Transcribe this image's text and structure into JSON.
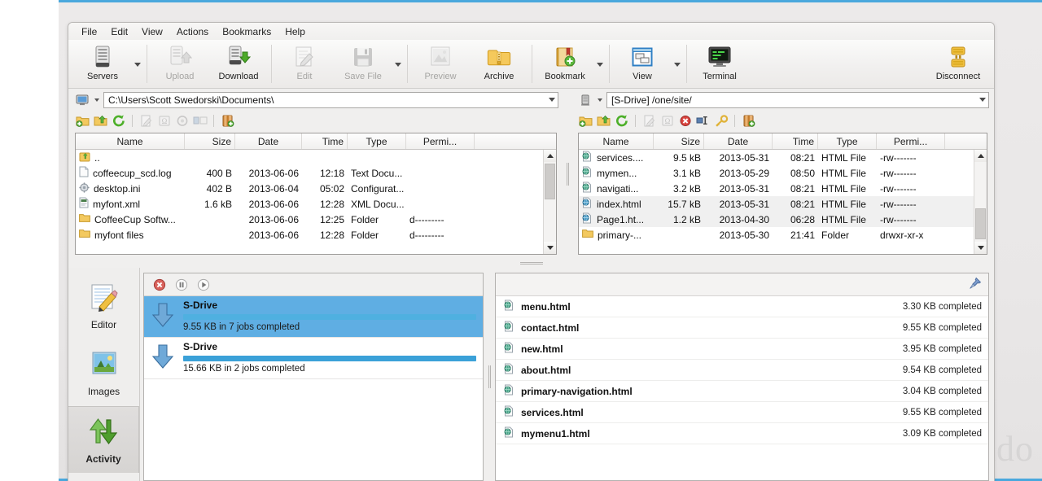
{
  "app": {
    "menu": [
      "File",
      "Edit",
      "View",
      "Actions",
      "Bookmarks",
      "Help"
    ]
  },
  "ribbon": {
    "buttons": [
      {
        "label": "Servers",
        "icon": "server-icon",
        "disabled": false,
        "dropdown": true
      },
      {
        "label": "Upload",
        "icon": "upload-icon",
        "disabled": true,
        "dropdown": false
      },
      {
        "label": "Download",
        "icon": "download-icon",
        "disabled": false,
        "dropdown": false
      },
      {
        "label": "Edit",
        "icon": "edit-icon",
        "disabled": true,
        "dropdown": false
      },
      {
        "label": "Save File",
        "icon": "save-icon",
        "disabled": true,
        "dropdown": true
      },
      {
        "label": "Preview",
        "icon": "preview-icon",
        "disabled": true,
        "dropdown": false
      },
      {
        "label": "Archive",
        "icon": "archive-icon",
        "disabled": false,
        "dropdown": false
      },
      {
        "label": "Bookmark",
        "icon": "bookmark-icon",
        "disabled": false,
        "dropdown": true
      },
      {
        "label": "View",
        "icon": "view-icon",
        "disabled": false,
        "dropdown": true
      },
      {
        "label": "Terminal",
        "icon": "terminal-icon",
        "disabled": false,
        "dropdown": false
      }
    ],
    "disconnect": {
      "label": "Disconnect",
      "icon": "disconnect-icon"
    }
  },
  "local_pane": {
    "path": "C:\\Users\\Scott Swedorski\\Documents\\",
    "toolbar_icons": [
      "new-folder-icon",
      "open-folder-icon",
      "refresh-icon",
      "edit-file-icon",
      "rename-icon",
      "properties-icon",
      "compare-icon",
      "archive-add-icon"
    ],
    "columns": [
      "Name",
      "Size",
      "Date",
      "Time",
      "Type",
      "Permi..."
    ],
    "rows": [
      {
        "icon": "parent-folder-icon",
        "name": "..",
        "size": "",
        "date": "",
        "time": "",
        "type": "",
        "perm": ""
      },
      {
        "icon": "text-file-icon",
        "name": "coffeecup_scd.log",
        "size": "400 B",
        "date": "2013-06-06",
        "time": "12:18",
        "type": "Text Docu...",
        "perm": ""
      },
      {
        "icon": "config-file-icon",
        "name": "desktop.ini",
        "size": "402 B",
        "date": "2013-06-04",
        "time": "05:02",
        "type": "Configurat...",
        "perm": ""
      },
      {
        "icon": "xml-file-icon",
        "name": "myfont.xml",
        "size": "1.6 kB",
        "date": "2013-06-06",
        "time": "12:28",
        "type": "XML Docu...",
        "perm": ""
      },
      {
        "icon": "folder-icon",
        "name": "CoffeeCup Softw...",
        "size": "",
        "date": "2013-06-06",
        "time": "12:25",
        "type": "Folder",
        "perm": "d---------"
      },
      {
        "icon": "folder-icon",
        "name": "myfont files",
        "size": "",
        "date": "2013-06-06",
        "time": "12:28",
        "type": "Folder",
        "perm": "d---------"
      }
    ]
  },
  "remote_pane": {
    "path": "[S-Drive] /one/site/",
    "toolbar_icons": [
      "new-folder-icon",
      "open-folder-icon",
      "refresh-icon",
      "edit-file-icon",
      "rename-icon",
      "delete-icon",
      "rename-field-icon",
      "permissions-icon",
      "archive-add-icon"
    ],
    "columns": [
      "Name",
      "Size",
      "Date",
      "Time",
      "Type",
      "Permi..."
    ],
    "rows": [
      {
        "icon": "html-file-icon",
        "name": "services....",
        "size": "9.5 kB",
        "date": "2013-05-31",
        "time": "08:21",
        "type": "HTML File",
        "perm": "-rw-------",
        "selected": false
      },
      {
        "icon": "html-file-icon",
        "name": "mymen...",
        "size": "3.1 kB",
        "date": "2013-05-29",
        "time": "08:50",
        "type": "HTML File",
        "perm": "-rw-------",
        "selected": false
      },
      {
        "icon": "html-file-icon",
        "name": "navigati...",
        "size": "3.2 kB",
        "date": "2013-05-31",
        "time": "08:21",
        "type": "HTML File",
        "perm": "-rw-------",
        "selected": false
      },
      {
        "icon": "html-file-icon",
        "name": "index.html",
        "size": "15.7 kB",
        "date": "2013-05-31",
        "time": "08:21",
        "type": "HTML File",
        "perm": "-rw-------",
        "selected": true
      },
      {
        "icon": "html-file-icon",
        "name": "Page1.ht...",
        "size": "1.2 kB",
        "date": "2013-04-30",
        "time": "06:28",
        "type": "HTML File",
        "perm": "-rw-------",
        "selected": true
      },
      {
        "icon": "folder-icon",
        "name": "primary-...",
        "size": "",
        "date": "2013-05-30",
        "time": "21:41",
        "type": "Folder",
        "perm": "drwxr-xr-x",
        "selected": false
      }
    ]
  },
  "navstrip": {
    "items": [
      {
        "label": "Editor",
        "icon": "editor-icon",
        "active": false
      },
      {
        "label": "Images",
        "icon": "images-icon",
        "active": false
      },
      {
        "label": "Activity",
        "icon": "activity-icon",
        "active": true
      }
    ]
  },
  "queue": {
    "toolbar": [
      {
        "name": "stop-button",
        "icon": "stop-icon"
      },
      {
        "name": "pause-button",
        "icon": "pause-icon"
      },
      {
        "name": "play-button",
        "icon": "play-icon"
      }
    ],
    "jobs": [
      {
        "title": "S-Drive",
        "status": "9.55 KB in 7 jobs completed",
        "progress": 100,
        "selected": true,
        "icon": "download-arrow-icon"
      },
      {
        "title": "S-Drive",
        "status": "15.66 KB in 2 jobs completed",
        "progress": 100,
        "selected": false,
        "icon": "download-arrow-icon"
      }
    ],
    "pin": {
      "name": "pin-icon",
      "label": "pin"
    },
    "files": [
      {
        "icon": "html-file-icon",
        "name": "menu.html",
        "size": "3.30 KB completed"
      },
      {
        "icon": "html-file-icon",
        "name": "contact.html",
        "size": "9.55 KB completed"
      },
      {
        "icon": "html-file-icon",
        "name": "new.html",
        "size": "3.95 KB completed"
      },
      {
        "icon": "html-file-icon",
        "name": "about.html",
        "size": "9.54 KB completed"
      },
      {
        "icon": "html-file-icon",
        "name": "primary-navigation.html",
        "size": "3.04 KB completed"
      },
      {
        "icon": "html-file-icon",
        "name": "services.html",
        "size": "9.55 KB completed"
      },
      {
        "icon": "html-file-icon",
        "name": "mymenu1.html",
        "size": "3.09 KB completed"
      }
    ]
  },
  "watermark": "ndo",
  "colors": {
    "accent": "#4aa8dd",
    "selection": "#5faee3",
    "progress": "#3ba1d8",
    "window_bg": "#f0efee"
  }
}
